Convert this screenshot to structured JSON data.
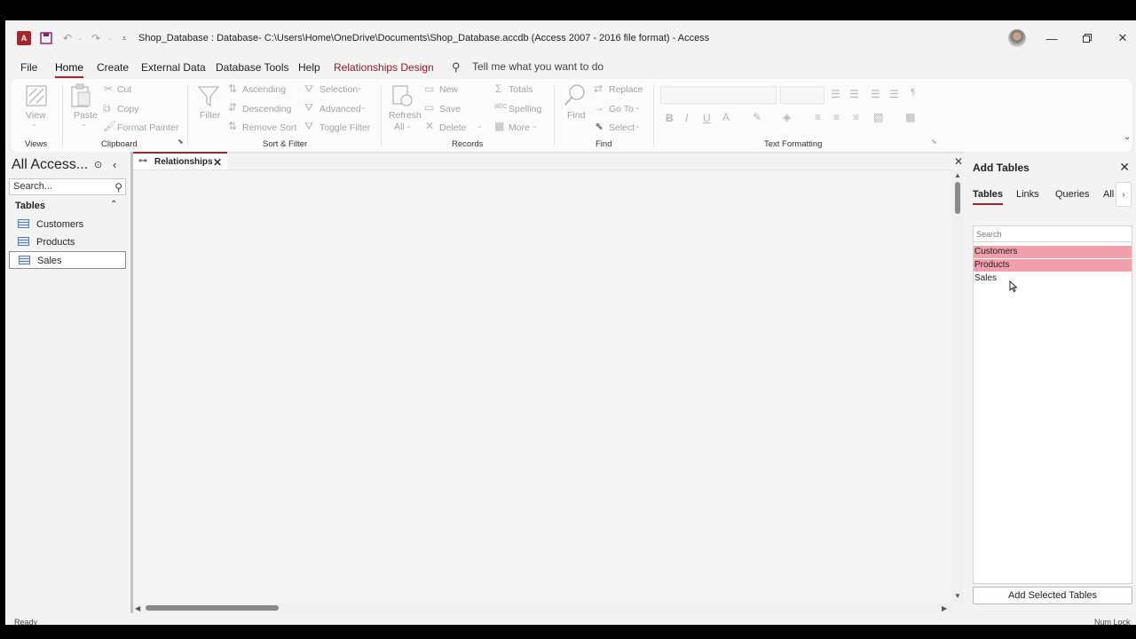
{
  "titlebar": {
    "title": "Shop_Database : Database- C:\\Users\\Home\\OneDrive\\Documents\\Shop_Database.accdb (Access 2007 - 2016 file format)  -  Access",
    "app_icon": "access-logo-icon",
    "app_icon_label": "A"
  },
  "menu": {
    "file": "File",
    "home": "Home",
    "create": "Create",
    "external_data": "External Data",
    "database_tools": "Database Tools",
    "help": "Help",
    "relationships_design": "Relationships Design",
    "tell_me": "Tell me what you want to do"
  },
  "ribbon": {
    "view": "View",
    "paste": "Paste",
    "cut": "Cut",
    "copy": "Copy",
    "format_painter": "Format Painter",
    "filter": "Filter",
    "ascending": "Ascending",
    "descending": "Descending",
    "remove_sort": "Remove Sort",
    "selection": "Selection",
    "advanced": "Advanced",
    "toggle_filter": "Toggle Filter",
    "refresh": "Refresh",
    "refresh_all": "All",
    "new": "New",
    "save": "Save",
    "delete": "Delete",
    "totals": "Totals",
    "spelling": "Spelling",
    "more": "More",
    "find": "Find",
    "replace": "Replace",
    "go_to": "Go To",
    "select": "Select",
    "groups": {
      "views": "Views",
      "clipboard": "Clipboard",
      "sort_filter": "Sort & Filter",
      "records": "Records",
      "find": "Find",
      "text_formatting": "Text Formatting"
    }
  },
  "nav": {
    "title": "All Access...",
    "search_placeholder": "Search...",
    "section": "Tables",
    "items": [
      {
        "label": "Customers"
      },
      {
        "label": "Products"
      },
      {
        "label": "Sales"
      }
    ]
  },
  "document": {
    "tab_label": "Relationships"
  },
  "pane": {
    "title": "Add Tables",
    "tabs": [
      "Tables",
      "Links",
      "Queries",
      "All"
    ],
    "search_placeholder": "Search",
    "rows": [
      {
        "label": "Customers",
        "highlighted": true
      },
      {
        "label": "Products",
        "highlighted": true
      },
      {
        "label": "Sales",
        "highlighted": false
      }
    ],
    "add_button": "Add Selected Tables"
  },
  "status": {
    "left": "Ready",
    "right": "Num Lock"
  },
  "colors": {
    "accent": "#a4262c",
    "highlight": "#f0a0ab"
  }
}
